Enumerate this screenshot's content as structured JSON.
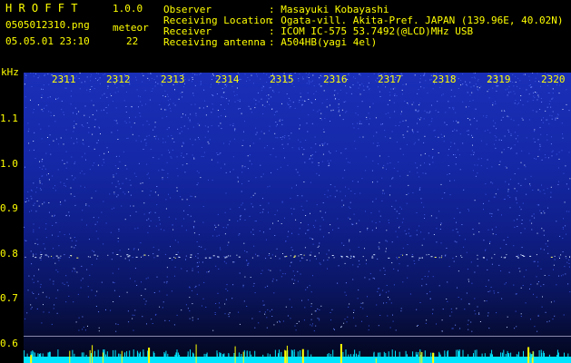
{
  "header": {
    "app_title": "H R O F F T",
    "version": "1.0.0",
    "filename": "0505012310.png",
    "meteor_label": "meteor",
    "datetime": "05.05.01 23:10",
    "meteor_count": "22"
  },
  "info": [
    {
      "key": "Observer",
      "value": ": Masayuki Kobayashi"
    },
    {
      "key": "Receiving Location",
      "value": ": Ogata-vill. Akita-Pref. JAPAN (139.96E, 40.02N)"
    },
    {
      "key": "Receiver",
      "value": ": ICOM IC-575 53.7492(@LCD)MHz USB"
    },
    {
      "key": "Receiving antenna",
      "value": ": A504HB(yagi 4el)"
    }
  ],
  "axis": {
    "unit": "kHz",
    "time_ticks": [
      "2311",
      "2312",
      "2313",
      "2314",
      "2315",
      "2316",
      "2317",
      "2318",
      "2319",
      "2320"
    ],
    "freq_ticks": [
      "1.1",
      "1.0",
      "0.9",
      "0.8",
      "0.7",
      "0.6"
    ]
  },
  "colors": {
    "label": "#ffff00",
    "meteor_echo": "#ffff00",
    "noise_floor": "#00e5ff"
  }
}
